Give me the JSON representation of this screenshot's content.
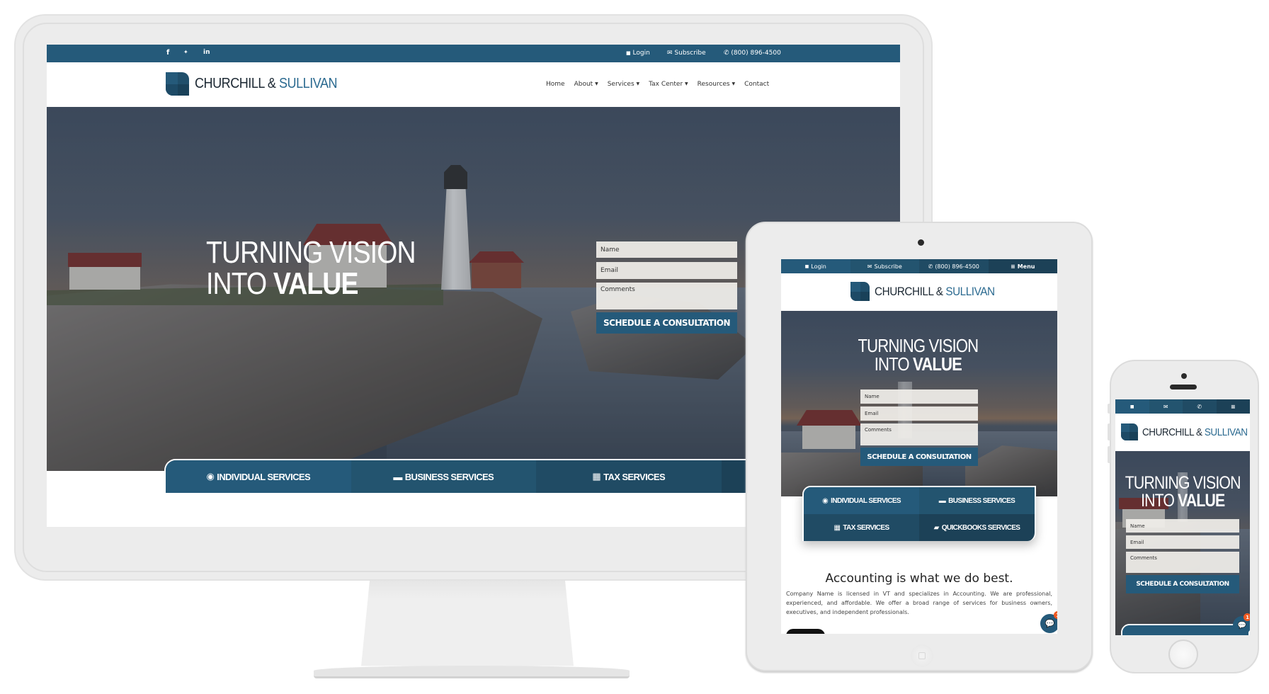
{
  "brand": {
    "name_dark": "CHURCHILL &",
    "name_blue": "SULLIVAN"
  },
  "colors": {
    "primary": "#255a7a",
    "primary_dark": "#1c4157",
    "accent_badge": "#f05a22",
    "device_body": "#ececec"
  },
  "desktop": {
    "topbar": {
      "social": [
        {
          "icon": "facebook-icon",
          "glyph": "f"
        },
        {
          "icon": "twitter-icon",
          "glyph": "🐦"
        },
        {
          "icon": "linkedin-icon",
          "glyph": "in"
        }
      ],
      "links": [
        {
          "icon": "lock-icon",
          "glyph": "🔒",
          "label": "Login"
        },
        {
          "icon": "envelope-icon",
          "glyph": "✉",
          "label": "Subscribe"
        },
        {
          "icon": "phone-icon",
          "glyph": "✆",
          "label": "(800) 896-4500"
        }
      ]
    },
    "nav": [
      {
        "label": "Home",
        "dropdown": false
      },
      {
        "label": "About",
        "dropdown": true
      },
      {
        "label": "Services",
        "dropdown": true
      },
      {
        "label": "Tax Center",
        "dropdown": true
      },
      {
        "label": "Resources",
        "dropdown": true
      },
      {
        "label": "Contact",
        "dropdown": false
      }
    ],
    "hero": {
      "line1": "TURNING VISION",
      "line2_light": "INTO",
      "line2_bold": "VALUE"
    },
    "form": {
      "name_placeholder": "Name",
      "email_placeholder": "Email",
      "comments_placeholder": "Comments",
      "submit": "SCHEDULE A CONSULTATION"
    },
    "services": [
      {
        "icon": "user-circle-icon",
        "glyph": "◉",
        "label": "INDIVIDUAL SERVICES"
      },
      {
        "icon": "briefcase-icon",
        "glyph": "▬",
        "label": "BUSINESS SERVICES"
      },
      {
        "icon": "calendar-icon",
        "glyph": "▦",
        "label": "TAX SERVICES"
      },
      {
        "icon": "book-icon",
        "glyph": "▰",
        "label": "QUICKBOOKS SERVICES"
      }
    ]
  },
  "tablet": {
    "topbar": [
      {
        "icon": "lock-icon",
        "glyph": "🔒",
        "label": "Login"
      },
      {
        "icon": "envelope-icon",
        "glyph": "✉",
        "label": "Subscribe"
      },
      {
        "icon": "phone-icon",
        "glyph": "✆",
        "label": "(800) 896-4500"
      },
      {
        "icon": "menu-icon",
        "glyph": "≡",
        "label": "Menu"
      }
    ],
    "about": {
      "heading": "Accounting is what we do best.",
      "body": "Company Name is licensed in VT and specializes in Accounting. We are professional, experienced, and affordable. We offer a broad range of services for business owners, executives, and independent professionals."
    },
    "chat_badge": "1"
  },
  "phone": {
    "topbar": [
      {
        "icon": "lock-icon",
        "glyph": "🔒"
      },
      {
        "icon": "envelope-icon",
        "glyph": "✉"
      },
      {
        "icon": "phone-icon",
        "glyph": "✆"
      },
      {
        "icon": "menu-icon",
        "glyph": "≡"
      }
    ],
    "chat_badge": "1"
  }
}
